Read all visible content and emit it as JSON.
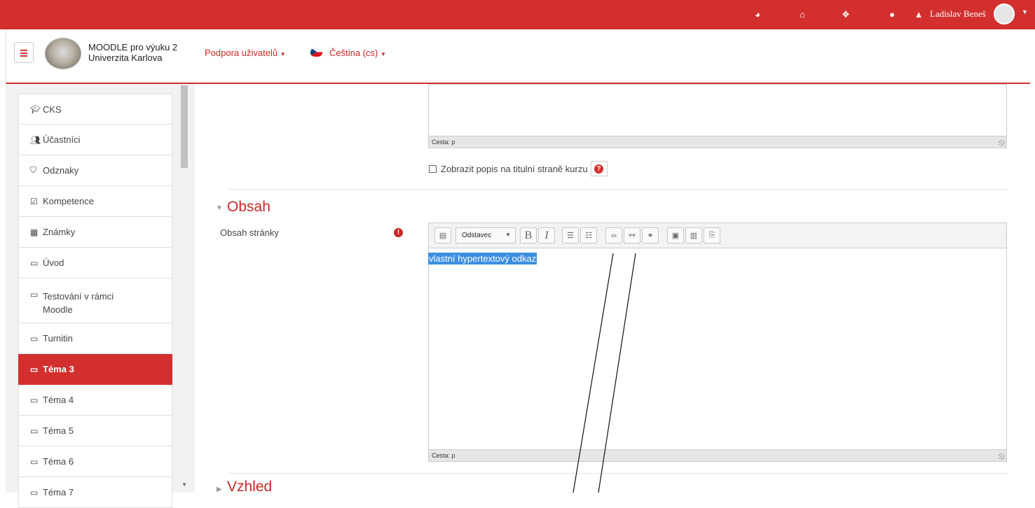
{
  "topbar": {
    "icons": [
      "dashboard-icon",
      "home-icon",
      "cubes-icon",
      "chat-icon",
      "bell-icon"
    ],
    "user_name": "Ladislav Beneš"
  },
  "navbar": {
    "site_line1": "MOODLE pro výuku 2",
    "site_line2": "Univerzita Karlova",
    "support_link": "Podpora uživatelů",
    "language": "Čeština (cs)"
  },
  "sidebar": {
    "items": [
      {
        "label": "CKS",
        "icon": "graduation-cap-icon"
      },
      {
        "label": "Účastníci",
        "icon": "users-icon"
      },
      {
        "label": "Odznaky",
        "icon": "shield-icon"
      },
      {
        "label": "Kompetence",
        "icon": "checkbox-icon"
      },
      {
        "label": "Známky",
        "icon": "table-icon"
      },
      {
        "label": "Úvod",
        "icon": "folder-icon"
      },
      {
        "label": "Testování v rámci Moodle",
        "icon": "folder-icon"
      },
      {
        "label": "Turnitin",
        "icon": "folder-icon"
      },
      {
        "label": "Téma 3",
        "icon": "folder-icon",
        "active": true
      },
      {
        "label": "Téma 4",
        "icon": "folder-icon"
      },
      {
        "label": "Téma 5",
        "icon": "folder-icon"
      },
      {
        "label": "Téma 6",
        "icon": "folder-icon"
      },
      {
        "label": "Téma 7",
        "icon": "folder-icon"
      }
    ]
  },
  "form": {
    "description_path": "Cesta: p",
    "show_description_label": "Zobrazit popis na titulní straně kurzu",
    "section_content_title": "Obsah",
    "content_label": "Obsah stránky",
    "format_select": "Odstavec",
    "bold_label": "B",
    "italic_label": "I",
    "editor_text": "vlastní hypertextový odkaz",
    "content_path": "Cesta: p",
    "section_appearance_title": "Vzhled"
  },
  "colors": {
    "brand_red": "#d32f2f",
    "selection_blue": "#3c8fe0"
  }
}
